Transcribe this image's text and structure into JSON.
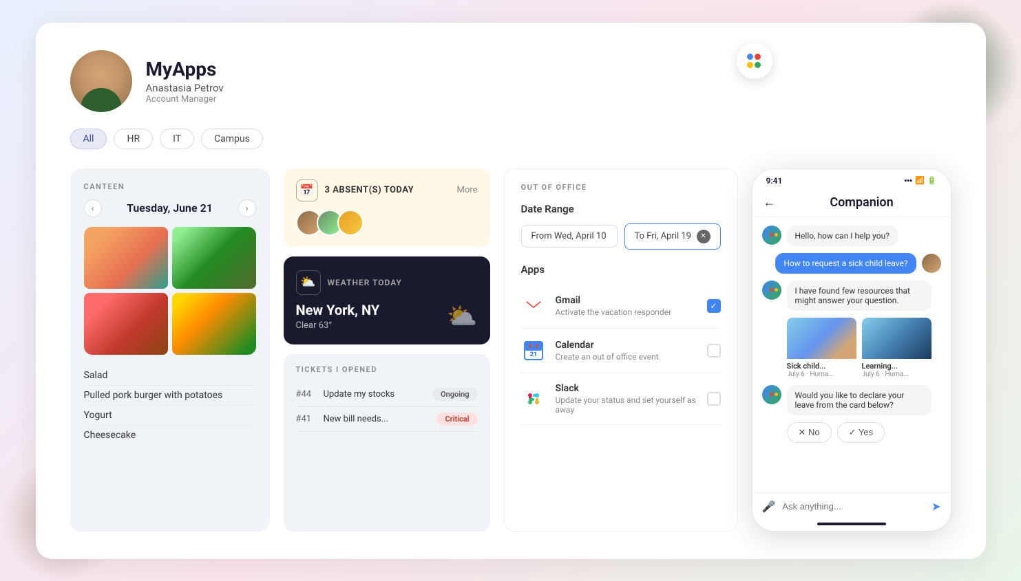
{
  "header": {
    "app_title": "MyApps",
    "user_name": "Anastasia Petrov",
    "user_role": "Account Manager"
  },
  "filter_tabs": {
    "tabs": [
      "All",
      "HR",
      "IT",
      "Campus"
    ],
    "active": "All"
  },
  "canteen": {
    "label": "CANTEEN",
    "date": "Tuesday, June 21",
    "menu_items": [
      "Salad",
      "Pulled pork burger with potatoes",
      "Yogurt",
      "Cheesecake"
    ]
  },
  "absent": {
    "title": "3 ABSENT(S) TODAY",
    "more": "More"
  },
  "weather": {
    "label": "WEATHER TODAY",
    "city": "New York, NY",
    "description": "Clear 63°"
  },
  "tickets": {
    "label": "TICKETS I OPENED",
    "items": [
      {
        "id": "#44",
        "title": "Update my stocks",
        "status": "Ongoing",
        "status_type": "ongoing"
      },
      {
        "id": "#41",
        "title": "New bill needs...",
        "status": "Critical",
        "status_type": "critical"
      }
    ]
  },
  "out_of_office": {
    "label": "OUT OF OFFICE",
    "date_range_label": "Date Range",
    "from": "From Wed, April 10",
    "to": "To Fri, April 19",
    "apps_label": "Apps",
    "apps": [
      {
        "name": "Gmail",
        "desc": "Activate the vacation responder",
        "checked": true,
        "icon": "gmail"
      },
      {
        "name": "Calendar",
        "desc": "Create an out of office event",
        "checked": false,
        "icon": "calendar"
      },
      {
        "name": "Slack",
        "desc": "Update your status and set yourself as away",
        "checked": false,
        "icon": "slack"
      }
    ]
  },
  "companion": {
    "title": "Companion",
    "time": "9:41",
    "messages": [
      {
        "type": "bot",
        "text": "Hello, how can I help you?"
      },
      {
        "type": "user",
        "text": "How to request a sick child leave?"
      },
      {
        "type": "bot",
        "text": "I have found few resources that might answer your question."
      },
      {
        "type": "bot",
        "text": "Would you like to declare your leave from the card below?"
      }
    ],
    "resources": [
      {
        "label": "Sick child...",
        "meta": "July 6 · Huma..."
      },
      {
        "label": "Learning...",
        "meta": "July 6 · Huma..."
      }
    ],
    "yn_buttons": [
      {
        "label": "No",
        "type": "no"
      },
      {
        "label": "Yes",
        "type": "yes"
      }
    ],
    "input_placeholder": "Ask anything..."
  }
}
